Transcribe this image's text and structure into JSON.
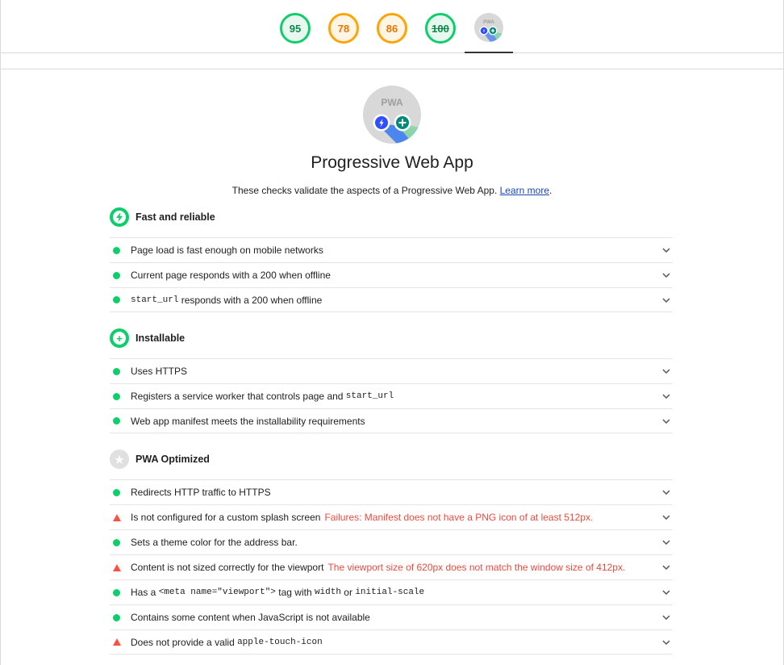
{
  "scores": [
    {
      "value": "95",
      "status": "pass"
    },
    {
      "value": "78",
      "status": "average"
    },
    {
      "value": "86",
      "status": "average"
    },
    {
      "value": "100",
      "status": "pass"
    }
  ],
  "pwa_badge": {
    "text": "PWA"
  },
  "category": {
    "title": "Progressive Web App",
    "description": "These checks validate the aspects of a Progressive Web App.",
    "learn_more": "Learn more",
    "period": "."
  },
  "groups": {
    "fast": {
      "title": "Fast and reliable"
    },
    "installable": {
      "title": "Installable"
    },
    "optimized": {
      "title": "PWA Optimized"
    }
  },
  "audits": {
    "a1": {
      "text": "Page load is fast enough on mobile networks",
      "status": "pass"
    },
    "a2": {
      "text": "Current page responds with a 200 when offline",
      "status": "pass"
    },
    "a3": {
      "code": "start_url",
      "text": " responds with a 200 when offline",
      "status": "pass"
    },
    "b1": {
      "text": "Uses HTTPS",
      "status": "pass"
    },
    "b2": {
      "text": "Registers a service worker that controls page and ",
      "code": "start_url",
      "status": "pass"
    },
    "b3": {
      "text": "Web app manifest meets the installability requirements",
      "status": "pass"
    },
    "c1": {
      "text": "Redirects HTTP traffic to HTTPS",
      "status": "pass"
    },
    "c2": {
      "text": "Is not configured for a custom splash screen",
      "failure": "Failures: Manifest does not have a PNG icon of at least 512px.",
      "status": "fail"
    },
    "c3": {
      "text": "Sets a theme color for the address bar.",
      "status": "pass"
    },
    "c4": {
      "text": "Content is not sized correctly for the viewport",
      "failure": "The viewport size of 620px does not match the window size of 412px.",
      "status": "fail"
    },
    "c5": {
      "t1": "Has a ",
      "code1": "<meta name=\"viewport\">",
      "t2": " tag with ",
      "code2": "width",
      "t3": " or ",
      "code3": "initial-scale",
      "status": "pass"
    },
    "c6": {
      "text": "Contains some content when JavaScript is not available",
      "status": "pass"
    },
    "c7": {
      "text": "Does not provide a valid ",
      "code": "apple-touch-icon",
      "status": "fail"
    }
  },
  "colors": {
    "pass": "#0cce6b",
    "average": "#ffa400",
    "fail": "#ff4e42",
    "link": "#1a45b5"
  },
  "icons": [
    "lightning-icon",
    "plus-icon",
    "star-icon",
    "chevron-down-icon"
  ]
}
